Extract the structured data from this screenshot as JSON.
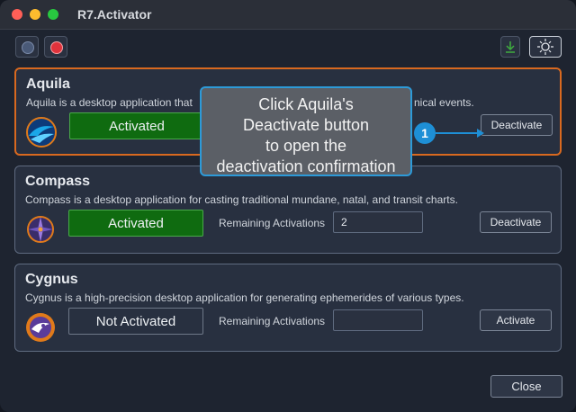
{
  "window": {
    "title": "R7.Activator"
  },
  "toolbar": {
    "icons": [
      "record-icon",
      "record-red-icon",
      "download-icon",
      "theme-sun-icon"
    ],
    "colors": {
      "download": "#3fae3f",
      "record_red": "#e0333c"
    }
  },
  "products": [
    {
      "name": "Aquila",
      "description": "Aquila is a desktop application that",
      "description_tail": "nical events.",
      "status": "Activated",
      "action": "Deactivate",
      "icon": "aquila-logo-icon"
    },
    {
      "name": "Compass",
      "description": "Compass is a desktop application for casting traditional mundane, natal, and transit charts.",
      "status": "Activated",
      "remaining_label": "Remaining Activations",
      "remaining_value": "2",
      "action": "Deactivate",
      "icon": "compass-logo-icon"
    },
    {
      "name": "Cygnus",
      "description": "Cygnus is a high-precision desktop application for generating ephemerides of various types.",
      "status": "Not Activated",
      "remaining_label": "Remaining Activations",
      "remaining_value": "",
      "action": "Activate",
      "icon": "cygnus-logo-icon"
    }
  ],
  "footer": {
    "close_label": "Close"
  },
  "tutorial": {
    "lines": [
      "Click Aquila's",
      "Deactivate button",
      "to open the",
      "deactivation confirmation"
    ],
    "step": "1"
  },
  "colors": {
    "accent": "#d9691f",
    "activated": "#0f6b10",
    "callout_border": "#2d9ad8"
  }
}
